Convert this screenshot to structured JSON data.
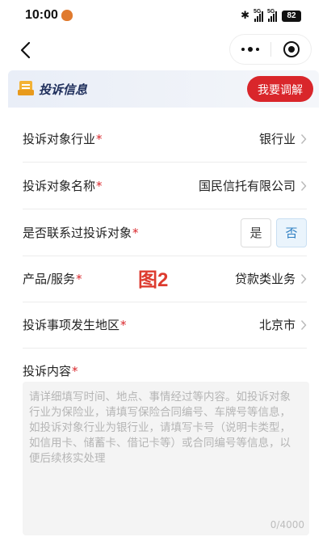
{
  "status_bar": {
    "time": "10:00",
    "signal1": "5G",
    "signal2": "5G",
    "battery": "82"
  },
  "section": {
    "title": "投诉信息",
    "mediate_button": "我要调解"
  },
  "form": {
    "industry": {
      "label": "投诉对象行业",
      "required": "*",
      "value": "银行业"
    },
    "name": {
      "label": "投诉对象名称",
      "required": "*",
      "value": "国民信托有限公司"
    },
    "contacted": {
      "label": "是否联系过投诉对象",
      "required": "*",
      "yes": "是",
      "no": "否",
      "selected": "否"
    },
    "product": {
      "label": "产品/服务",
      "required": "*",
      "value": "贷款类业务"
    },
    "region": {
      "label": "投诉事项发生地区",
      "required": "*",
      "value": "北京市"
    },
    "content": {
      "label": "投诉内容",
      "required": "*",
      "placeholder": "请详细填写时间、地点、事情经过等内容。如投诉对象行业为保险业，请填写保险合同编号、车牌号等信息，如投诉对象行业为银行业，请填写卡号（说明卡类型，如信用卡、储蓄卡、借记卡等）或合同编号等信息，以便后续核实处理",
      "counter": "0/4000"
    }
  },
  "watermark": "图2",
  "icons": [
    "back-arrow-icon",
    "more-dots-icon",
    "close-target-icon",
    "document-icon",
    "chevron-right-icon",
    "bluetooth-icon"
  ]
}
